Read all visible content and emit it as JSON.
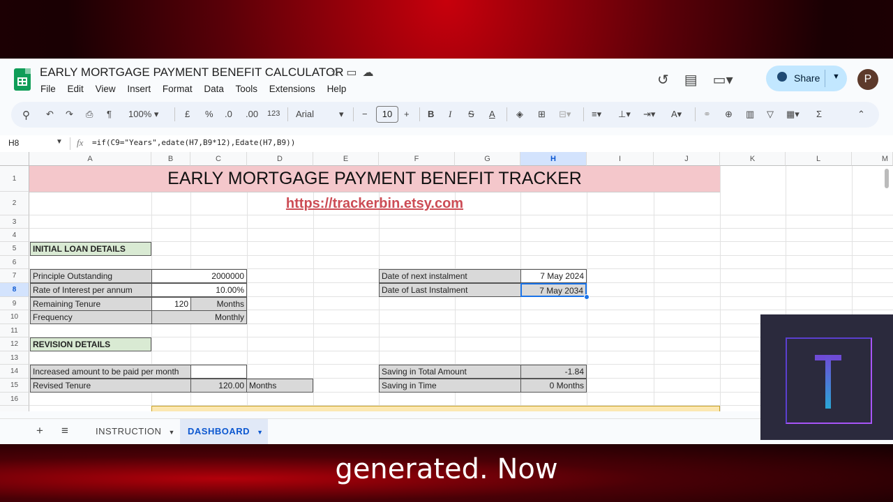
{
  "doc": {
    "title": "EARLY MORTGAGE PAYMENT BENEFIT CALCULATOR",
    "title_icons": [
      "star-icon",
      "move-to-folder-icon",
      "cloud-status-icon"
    ]
  },
  "menu": [
    "File",
    "Edit",
    "View",
    "Insert",
    "Format",
    "Data",
    "Tools",
    "Extensions",
    "Help"
  ],
  "header_right": {
    "share_label": "Share",
    "avatar_initial": "P",
    "icons": [
      "history-icon",
      "comments-icon",
      "meet-icon"
    ]
  },
  "toolbar": {
    "zoom": "100%",
    "currency": "£",
    "percent": "%",
    "dec_decrease": ".0",
    "dec_increase": ".00",
    "number_format": "123",
    "font": "Arial",
    "font_size": "10",
    "bold": "B",
    "italic": "I",
    "text_color": "A",
    "sum": "Σ"
  },
  "formula_bar": {
    "cell_ref": "H8",
    "fx": "fx",
    "formula": "=if(C9=\"Years\",edate(H7,B9*12),Edate(H7,B9))"
  },
  "columns": [
    "A",
    "B",
    "C",
    "D",
    "E",
    "F",
    "G",
    "H",
    "I",
    "J",
    "K",
    "L",
    "M"
  ],
  "rows": [
    "1",
    "2",
    "3",
    "4",
    "5",
    "6",
    "7",
    "8",
    "9",
    "10",
    "11",
    "12",
    "13",
    "14",
    "15",
    "16"
  ],
  "sheet": {
    "banner": "EARLY MORTGAGE PAYMENT BENEFIT TRACKER",
    "link": "https://trackerbin.etsy.com",
    "initial_section": "INITIAL LOAN DETAILS",
    "revision_section": "REVISION DETAILS",
    "principle_label": "Principle Outstanding",
    "principle_value": "2000000",
    "rate_label": "Rate of Interest per annum",
    "rate_value": "10.00%",
    "tenure_label": "Remaining Tenure",
    "tenure_value": "120",
    "tenure_unit": "Months",
    "frequency_label": "Frequency",
    "frequency_value": "Monthly",
    "increased_label": "Increased amount to be paid per month",
    "increased_value": "",
    "revised_label": "Revised Tenure",
    "revised_value": "120.00",
    "revised_unit": "Months",
    "next_inst_label": "Date of  next instalment",
    "next_inst_value": "7 May 2024",
    "last_inst_label": "Date of Last Instalment",
    "last_inst_value": "7 May 2034",
    "saving_amount_label": "Saving in Total Amount",
    "saving_amount_value": "-1.84",
    "saving_time_label": "Saving in Time",
    "saving_time_value": "0 Months"
  },
  "tabs": {
    "add": "+",
    "all_sheets": "≡",
    "instruction": "INSTRUCTION",
    "dashboard": "DASHBOARD"
  },
  "caption": "generated. Now"
}
